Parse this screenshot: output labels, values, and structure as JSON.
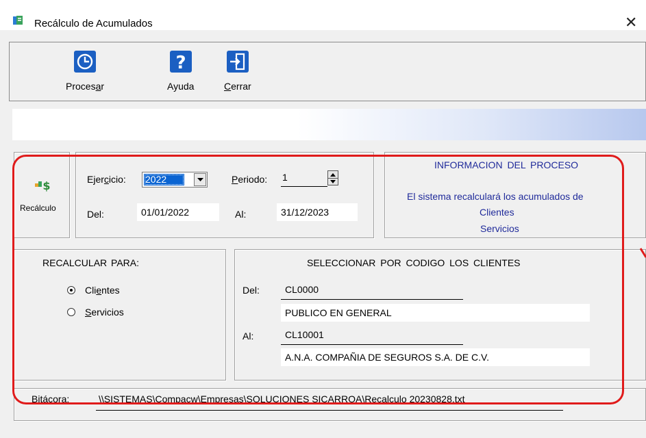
{
  "window": {
    "title": "Recálculo de Acumulados"
  },
  "toolbar": {
    "procesar": {
      "pre": "Proces",
      "ul": "a",
      "post": "r"
    },
    "ayuda": "Ayuda",
    "cerrar": {
      "ul": "C",
      "post": "errar"
    }
  },
  "side": {
    "label": "Recálculo"
  },
  "params": {
    "ejercicio": {
      "pre": "Ejer",
      "ul": "c",
      "post": "icio:",
      "value": "2022"
    },
    "periodo": {
      "ul": "P",
      "post": "eriodo:",
      "value": "1"
    },
    "del_label": "Del:",
    "del_value": "01/01/2022",
    "al_label": "Al:",
    "al_value": "31/12/2023"
  },
  "info": {
    "title": "INFORMACION DEL PROCESO",
    "line1": "El sistema recalculará los acumulados de",
    "line2": "Clientes",
    "line3": "Servicios"
  },
  "recalcular": {
    "title": "RECALCULAR PARA:",
    "opt1": {
      "pre": "Cli",
      "ul": "e",
      "post": "ntes"
    },
    "opt2": {
      "ul": "S",
      "post": "ervicios"
    }
  },
  "seleccionar": {
    "title": "SELECCIONAR POR CODIGO LOS CLIENTES",
    "del_label": "Del:",
    "del_code": "CL0000",
    "del_name": "PUBLICO EN GENERAL",
    "al_label": "Al:",
    "al_code": "CL10001",
    "al_name": "A.N.A. COMPAÑIA DE SEGUROS S.A. DE C.V."
  },
  "bitacora": {
    "label_ul": "B",
    "label_post": "itácora:",
    "path": "\\\\SISTEMAS\\Compacw\\Empresas\\SOLUCIONES SICARROA\\Recalculo 20230828.txt"
  },
  "colors": {
    "info_text": "#1f2a9a",
    "annotation": "#e01b1b"
  }
}
